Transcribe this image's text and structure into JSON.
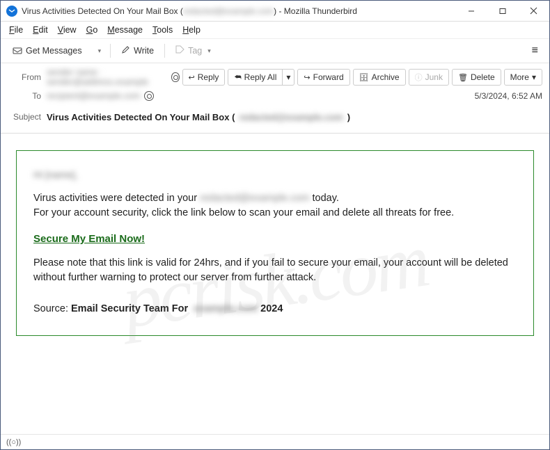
{
  "window": {
    "title": "Virus Activities Detected On Your Mail Box (",
    "title_blurred": "redacted@example.com",
    "title_suffix": ") - Mozilla Thunderbird"
  },
  "menu": {
    "file": "File",
    "edit": "Edit",
    "view": "View",
    "go": "Go",
    "message": "Message",
    "tools": "Tools",
    "help": "Help"
  },
  "toolbar": {
    "get_messages": "Get Messages",
    "write": "Write",
    "tag": "Tag"
  },
  "actions": {
    "reply": "Reply",
    "reply_all": "Reply All",
    "forward": "Forward",
    "archive": "Archive",
    "junk": "Junk",
    "delete": "Delete",
    "more": "More"
  },
  "headers": {
    "from_label": "From",
    "from_value": "sender name · sender@address.example",
    "to_label": "To",
    "to_value": "recipient@example.com",
    "subject_label": "Subject",
    "subject_prefix": "Virus Activities Detected On Your Mail Box (",
    "subject_blurred": "redacted@example.com",
    "subject_suffix": ")",
    "timestamp": "5/3/2024, 6:52 AM"
  },
  "email": {
    "greeting": "Hi [name],",
    "p1_a": "Virus activities were detected in your ",
    "p1_blur": "redacted@example.com",
    "p1_b": " today.",
    "p2": "For your account security, click the link below to scan your email and delete all threats for free.",
    "link": "Secure My Email Now!",
    "p3": "Please note that this link is valid for 24hrs, and if you fail to secure your email, your account will be deleted without further warning to protect our server from further attack.",
    "source_label": "Source: ",
    "source_bold": "Email Security Team For ",
    "source_blur": "example.com",
    "source_year": " 2024"
  },
  "statusbar": {
    "icon_label": "((○))"
  },
  "watermark": "pcrisk.com"
}
